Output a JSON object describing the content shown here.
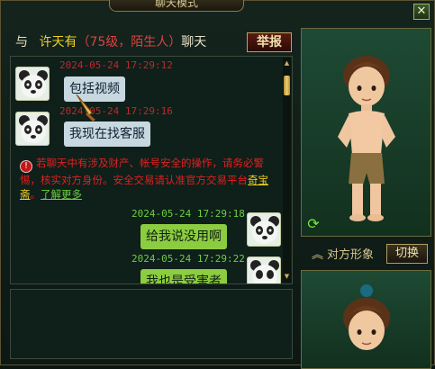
{
  "window": {
    "title": "聊天模式",
    "close_label": "✕"
  },
  "header": {
    "prefix": "与",
    "partner_name": "许天有",
    "partner_info": "（75级，陌生人）",
    "suffix": "聊天",
    "report_label": "举报"
  },
  "messages": [
    {
      "side": "left",
      "time": "2024-05-24 17:29:12",
      "text": "包括视频"
    },
    {
      "side": "left",
      "time": "2024-05-24 17:29:16",
      "text": "我现在找客服"
    },
    {
      "side": "right",
      "time": "2024-05-24 17:29:18",
      "text": "给我说没用啊"
    },
    {
      "side": "right",
      "time": "2024-05-24 17:29:22",
      "text": "我也是受害者"
    }
  ],
  "warning": {
    "icon": "!",
    "text": "若聊天中有涉及财产、帐号安全的操作，请务必警惕，核实对方身份。安全交易请认准官方交易平台",
    "shop_link": "奇宝斋",
    "sep": "。",
    "more_link": "了解更多"
  },
  "right_panel": {
    "opponent_label": "对方形象",
    "switch_label": "切换"
  },
  "colors": {
    "accent": "#f0d020",
    "warning": "#e02020",
    "bubble_right": "#8ccc40",
    "bubble_left": "#c8d8e0"
  }
}
